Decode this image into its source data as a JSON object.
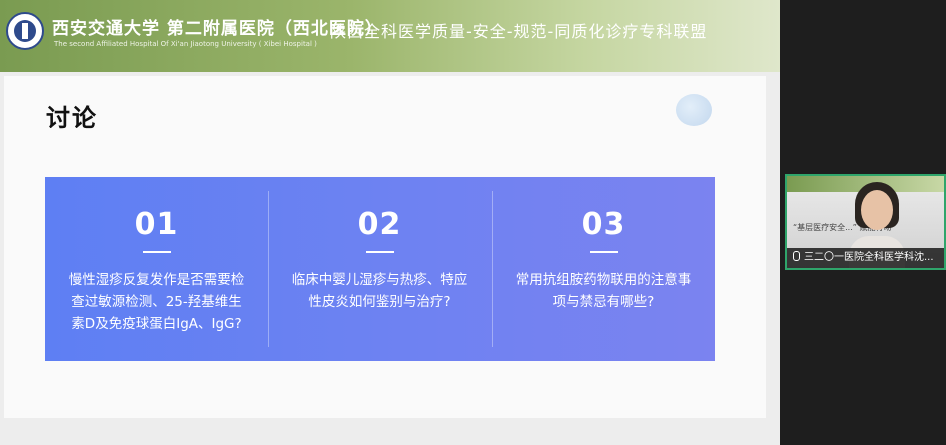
{
  "banner": {
    "hospital_cn": "西安交通大学 第二附属医院（西北医院）",
    "hospital_en": "The second Affiliated Hospital Of Xi'an Jiaotong University ( Xibei Hospital )",
    "alliance": "陕西全科医学质量-安全-规范-同质化诊疗专科联盟"
  },
  "slide": {
    "title": "讨论",
    "items": [
      {
        "num": "01",
        "text": "慢性湿疹反复发作是否需要检查过敏源检测、25-羟基维生素D及免疫球蛋白IgA、IgG?"
      },
      {
        "num": "02",
        "text": "临床中婴儿湿疹与热疹、特应性皮炎如何鉴别与治疗?"
      },
      {
        "num": "03",
        "text": "常用抗组胺药物联用的注意事项与禁忌有哪些?"
      }
    ]
  },
  "participant": {
    "name": "三二〇一医院全科医学科沈...",
    "backdrop_text": "“基层医疗安全...” 赋能行动"
  },
  "colors": {
    "panel_start": "#5e7ff3",
    "panel_end": "#7b83f0",
    "banner": "#7a9b51",
    "active_speaker_border": "#2fa56b"
  }
}
